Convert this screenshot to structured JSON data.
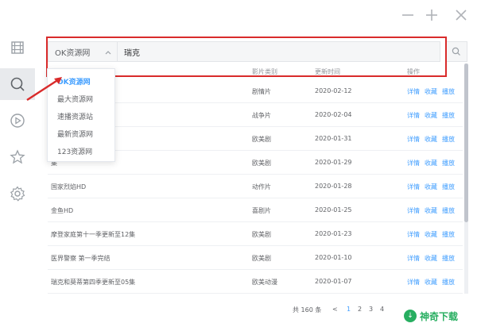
{
  "search": {
    "source_selected": "OK资源网",
    "query": "瑞克"
  },
  "table": {
    "headers": {
      "type": "影片类别",
      "date": "更新时间",
      "actions": "操作"
    },
    "rows": [
      {
        "title": "",
        "type": "剧情片",
        "date": "2020-02-12"
      },
      {
        "title": "",
        "type": "战争片",
        "date": "2020-02-04"
      },
      {
        "title": "",
        "type": "欧美剧",
        "date": "2020-01-31"
      },
      {
        "title": "集",
        "type": "欧美剧",
        "date": "2020-01-29"
      },
      {
        "title": "国家烈焰HD",
        "type": "动作片",
        "date": "2020-01-28"
      },
      {
        "title": "金鱼HD",
        "type": "喜剧片",
        "date": "2020-01-25"
      },
      {
        "title": "摩登家庭第十一季更新至12集",
        "type": "欧美剧",
        "date": "2020-01-23"
      },
      {
        "title": "医界警察 第一季完结",
        "type": "欧美剧",
        "date": "2020-01-10"
      },
      {
        "title": "瑞克和莫蒂第四季更新至05集",
        "type": "欧美动漫",
        "date": "2020-01-07"
      }
    ],
    "actions": {
      "detail": "详情",
      "favorite": "收藏",
      "play": "播放"
    }
  },
  "dropdown": {
    "options": [
      {
        "label": "OK资源网",
        "selected": true
      },
      {
        "label": "最大资源网",
        "selected": false
      },
      {
        "label": "速播资源站",
        "selected": false
      },
      {
        "label": "最新资源网",
        "selected": false
      },
      {
        "label": "123资源网",
        "selected": false
      }
    ]
  },
  "pagination": {
    "total": "共 160 条",
    "prev": "<",
    "pages": [
      "1",
      "2",
      "3",
      "4"
    ],
    "current": "1"
  },
  "watermark": {
    "text": "神奇下载"
  },
  "colors": {
    "accent": "#409eff",
    "highlight": "#d92b2b",
    "sidebar_active": "#e8eaed"
  },
  "icons": {
    "sidebar": [
      "film-icon",
      "search-icon",
      "play-icon",
      "star-icon",
      "settings-icon"
    ],
    "window": [
      "minimize-icon",
      "maximize-icon",
      "close-icon"
    ]
  }
}
